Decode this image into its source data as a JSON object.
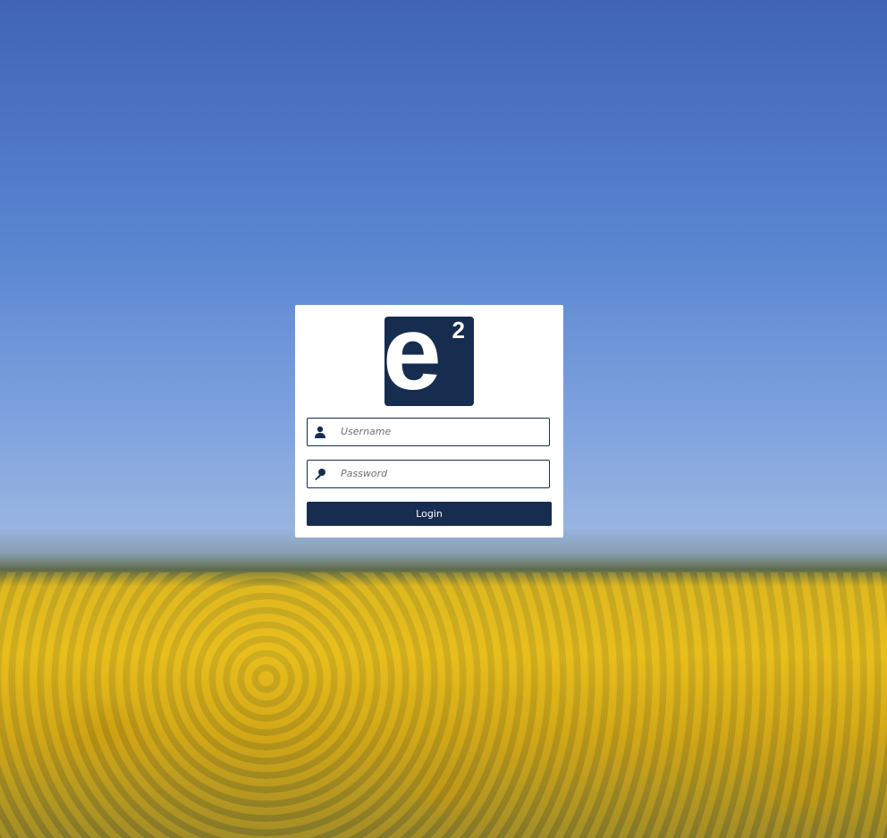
{
  "logo": {
    "letter": "e",
    "superscript": "2"
  },
  "form": {
    "username_placeholder": "Username",
    "password_placeholder": "Password",
    "login_label": "Login"
  },
  "colors": {
    "brand": "#172d50"
  },
  "icons": {
    "username": "user-icon",
    "password": "key-icon"
  }
}
